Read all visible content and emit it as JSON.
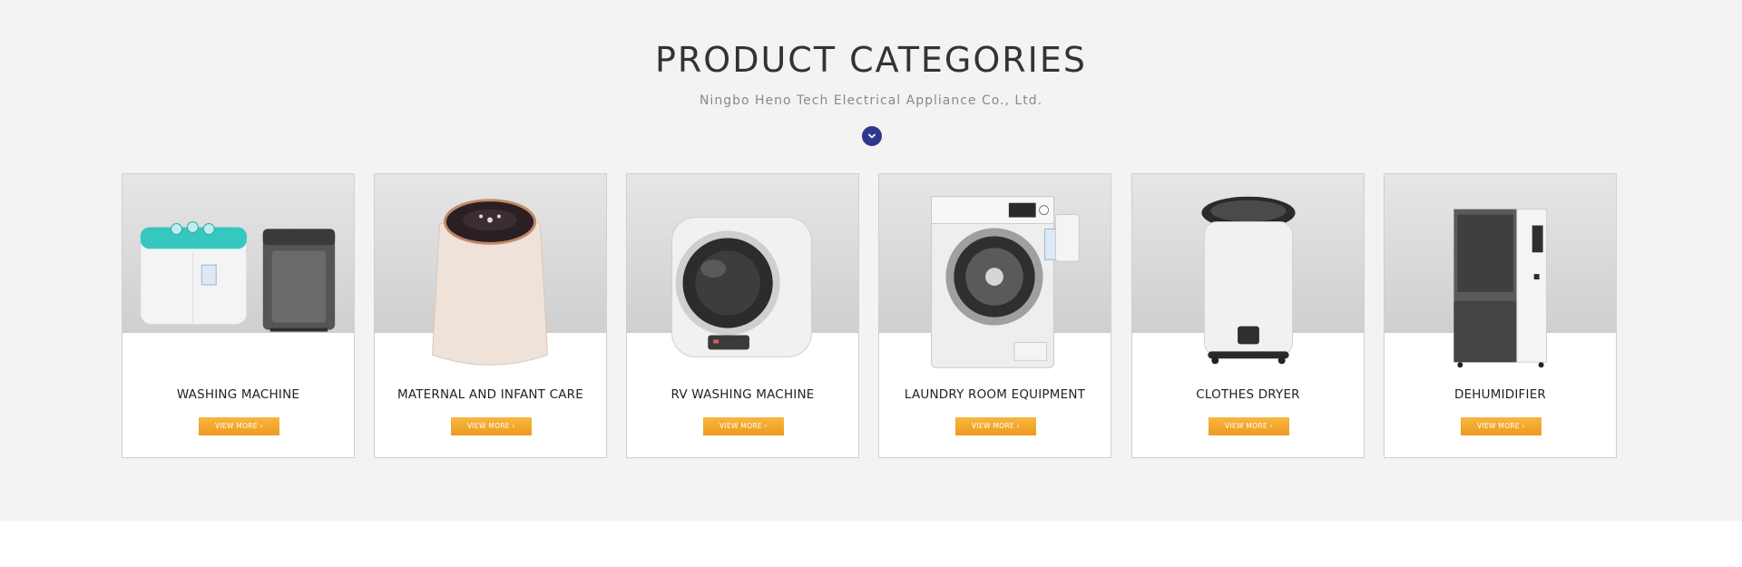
{
  "header": {
    "title": "PRODUCT CATEGORIES",
    "subtitle": "Ningbo Heno Tech Electrical Appliance Co., Ltd.",
    "scroll_icon": "chevron-down-icon"
  },
  "colors": {
    "accent": "#2d3a8c",
    "button": "#f2a52a",
    "section_bg": "#f3f3f3"
  },
  "categories": [
    {
      "label": "WASHING MACHINE",
      "button": "VIEW MORE ›",
      "icon": "twin-tub-washer-image"
    },
    {
      "label": "MATERNAL AND INFANT CARE",
      "button": "VIEW MORE ›",
      "icon": "mini-washer-image"
    },
    {
      "label": "RV WASHING MACHINE",
      "button": "VIEW MORE ›",
      "icon": "wall-mounted-washer-image"
    },
    {
      "label": "LAUNDRY ROOM EQUIPMENT",
      "button": "VIEW MORE ›",
      "icon": "front-load-washer-image"
    },
    {
      "label": "CLOTHES DRYER",
      "button": "VIEW MORE ›",
      "icon": "spin-dryer-image"
    },
    {
      "label": "DEHUMIDIFIER",
      "button": "VIEW MORE ›",
      "icon": "dehumidifier-image"
    }
  ]
}
